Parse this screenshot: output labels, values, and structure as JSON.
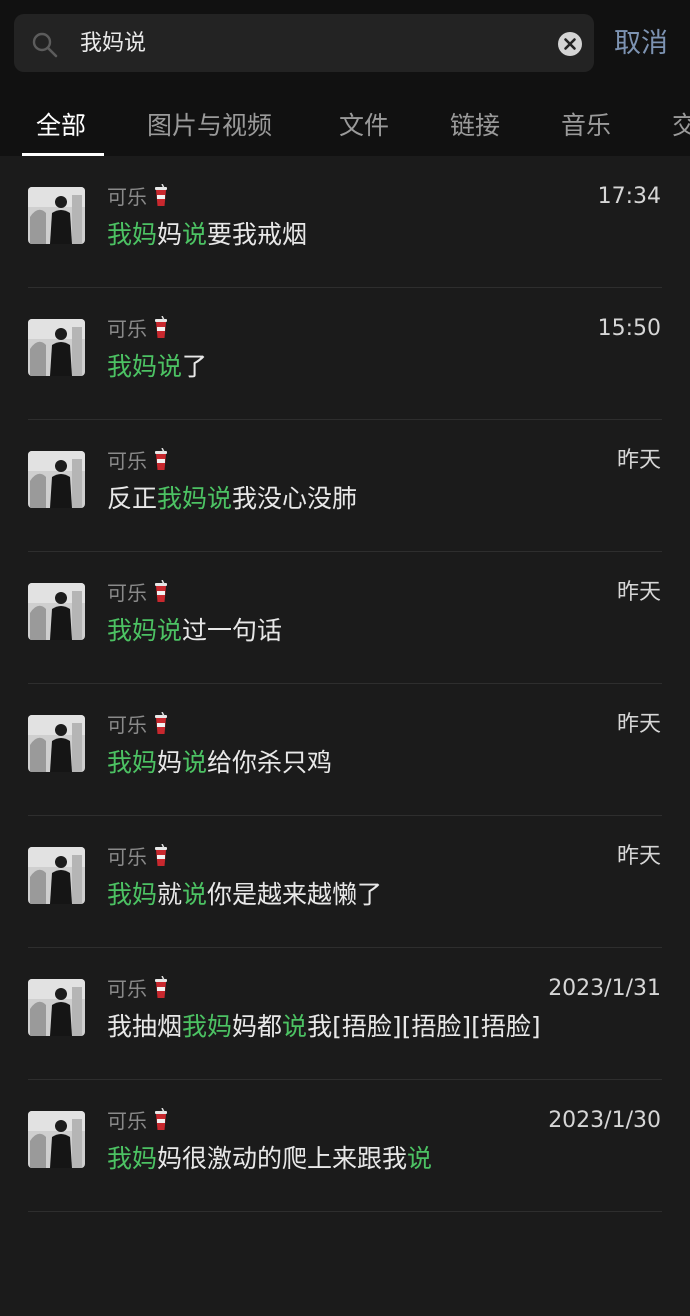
{
  "search": {
    "query": "我妈说",
    "cancel_label": "取消"
  },
  "tabs": [
    {
      "label": "全部",
      "active": true
    },
    {
      "label": "图片与视频",
      "active": false
    },
    {
      "label": "文件",
      "active": false
    },
    {
      "label": "链接",
      "active": false
    },
    {
      "label": "音乐",
      "active": false
    },
    {
      "label": "交",
      "active": false
    }
  ],
  "colors": {
    "highlight": "#4cc263",
    "cancel": "#7d93b2",
    "background": "#1b1b1b"
  },
  "results": [
    {
      "sender": "可乐",
      "sender_icon": "cup-icon",
      "time": "17:34",
      "parts": [
        [
          "我妈",
          true
        ],
        [
          "妈",
          false
        ],
        [
          "说",
          true
        ],
        [
          "要我戒烟",
          false
        ]
      ]
    },
    {
      "sender": "可乐",
      "sender_icon": "cup-icon",
      "time": "15:50",
      "parts": [
        [
          "我妈说",
          true
        ],
        [
          "了",
          false
        ]
      ]
    },
    {
      "sender": "可乐",
      "sender_icon": "cup-icon",
      "time": "昨天",
      "parts": [
        [
          "反正",
          false
        ],
        [
          "我妈说",
          true
        ],
        [
          "我没心没肺",
          false
        ]
      ]
    },
    {
      "sender": "可乐",
      "sender_icon": "cup-icon",
      "time": "昨天",
      "parts": [
        [
          "我妈说",
          true
        ],
        [
          "过一句话",
          false
        ]
      ]
    },
    {
      "sender": "可乐",
      "sender_icon": "cup-icon",
      "time": "昨天",
      "parts": [
        [
          "我妈",
          true
        ],
        [
          "妈",
          false
        ],
        [
          "说",
          true
        ],
        [
          "给你杀只鸡",
          false
        ]
      ]
    },
    {
      "sender": "可乐",
      "sender_icon": "cup-icon",
      "time": "昨天",
      "parts": [
        [
          "我妈",
          true
        ],
        [
          "就",
          false
        ],
        [
          "说",
          true
        ],
        [
          "你是越来越懒了",
          false
        ]
      ]
    },
    {
      "sender": "可乐",
      "sender_icon": "cup-icon",
      "time": "2023/1/31",
      "parts": [
        [
          "我抽烟",
          false
        ],
        [
          "我妈",
          true
        ],
        [
          "妈都",
          false
        ],
        [
          "说",
          true
        ],
        [
          "我[捂脸][捂脸][捂脸]",
          false
        ]
      ]
    },
    {
      "sender": "可乐",
      "sender_icon": "cup-icon",
      "time": "2023/1/30",
      "parts": [
        [
          "我妈",
          true
        ],
        [
          "妈很激动的爬上来跟我",
          false
        ],
        [
          "说",
          true
        ]
      ]
    }
  ]
}
